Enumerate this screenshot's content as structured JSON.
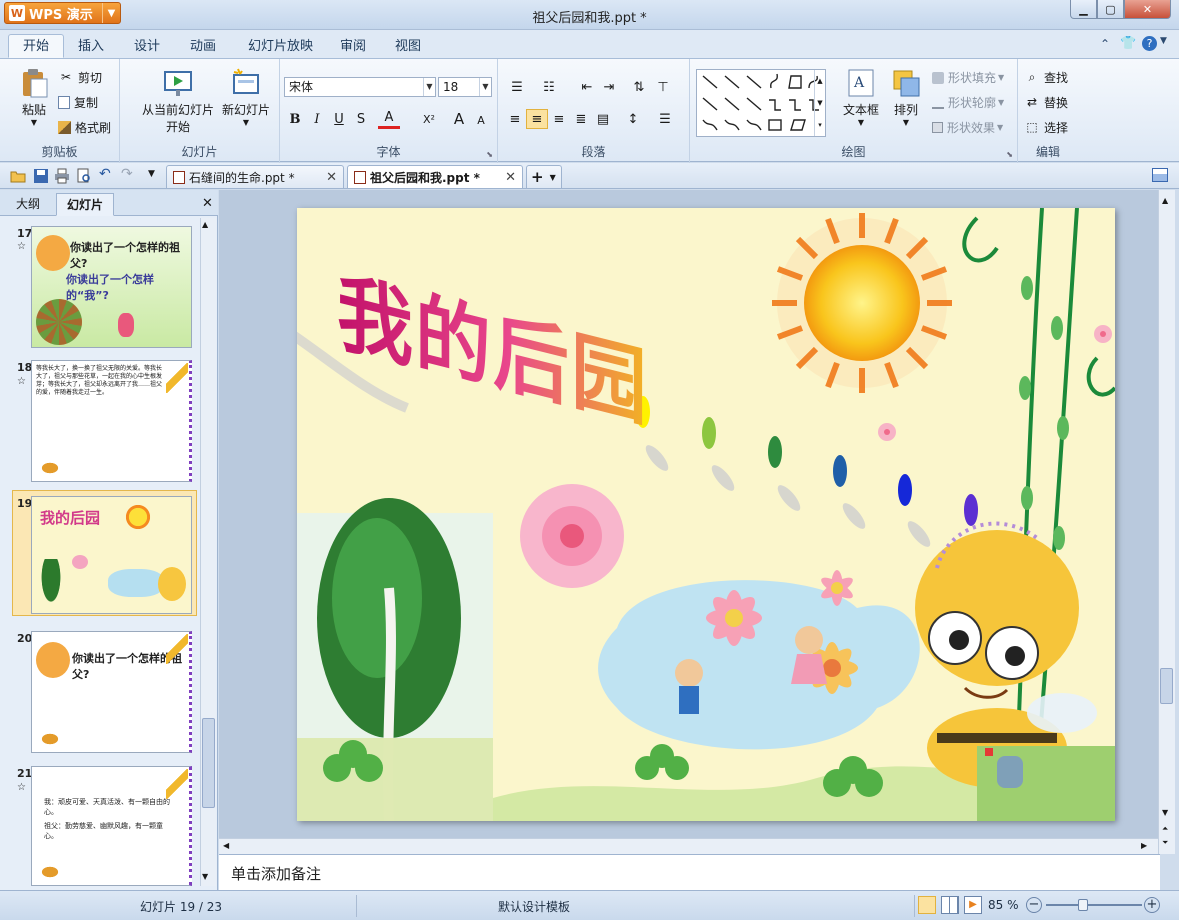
{
  "app": {
    "badge": "WPS 演示",
    "window_title": "祖父后园和我.ppt *"
  },
  "ribbon_tabs": [
    "开始",
    "插入",
    "设计",
    "动画",
    "幻灯片放映",
    "审阅",
    "视图"
  ],
  "clipboard": {
    "paste": "粘贴",
    "cut": "剪切",
    "copy": "复制",
    "format_painter": "格式刷",
    "label": "剪贴板"
  },
  "slides_group": {
    "from_current": "从当前幻灯片",
    "from_current2": "开始",
    "new_slide": "新幻灯片",
    "label": "幻灯片"
  },
  "font": {
    "family": "宋体",
    "size": "18",
    "label": "字体",
    "bold": "B",
    "italic": "I",
    "underline": "U",
    "strike": "S",
    "color": "A",
    "superscript": "X²",
    "grow": "A",
    "shrink": "A"
  },
  "paragraph": {
    "label": "段落"
  },
  "drawing": {
    "textbox": "文本框",
    "arrange": "排列",
    "shape_fill": "形状填充",
    "shape_outline": "形状轮廓",
    "shape_effect": "形状效果",
    "label": "绘图"
  },
  "editing": {
    "find": "查找",
    "replace": "替换",
    "select": "选择",
    "label": "编辑"
  },
  "doc_tabs": [
    {
      "title": "石缝间的生命.ppt *",
      "active": false
    },
    {
      "title": "祖父后园和我.ppt *",
      "active": true
    }
  ],
  "panel_tabs": {
    "outline": "大纲",
    "slides": "幻灯片"
  },
  "thumbnails": [
    {
      "num": "17",
      "line1": "你读出了一个怎样的祖父?",
      "line2": "你读出了一个怎样的“我”?"
    },
    {
      "num": "18",
      "text": "等我长大了，换一换了祖父无限的关爱。等我长大了，祖父与那些花草，一起在我的心中生根发芽；等我长大了，祖父却永远离开了我……祖父的爱，伴随着我走过一生。"
    },
    {
      "num": "19",
      "title": "我的后园"
    },
    {
      "num": "20",
      "line1": "你读出了一个怎样的祖父?"
    },
    {
      "num": "21",
      "line1": "我：顽皮可爱、天真活泼、有一颗自由的心。",
      "line2": "祖父：勤劳慈爱、幽默风趣，有一颗童心。"
    }
  ],
  "slide": {
    "title": "我的后园"
  },
  "notes_placeholder": "单击添加备注",
  "status": {
    "slide_counter": "幻灯片 19 / 23",
    "template": "默认设计模板",
    "zoom": "85 %"
  },
  "colors": {
    "accent_orange": "#e8821f",
    "ribbon_bg": "#dde8f5",
    "selection": "#fbe7b4"
  }
}
